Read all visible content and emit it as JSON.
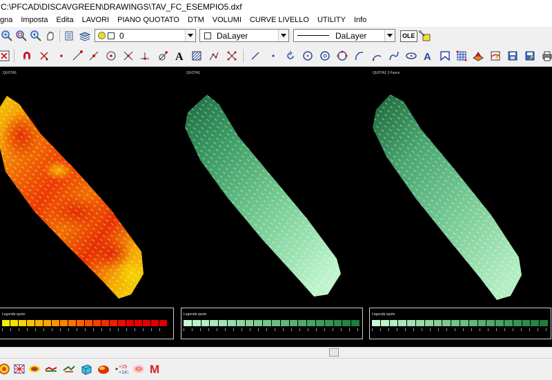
{
  "window": {
    "title": "C:\\PFCAD\\DISCAVGREEN\\DRAWINGS\\TAV_FC_ESEMPIO5.dxf"
  },
  "menu": [
    "gna",
    "Imposta",
    "Edita",
    "LAVORI",
    "PIANO QUOTATO",
    "DTM",
    "VOLUMI",
    "CURVE LIVELLO",
    "UTILITY",
    "Info"
  ],
  "toolbar1": {
    "layer_value": "0",
    "color_value": "DaLayer",
    "linetype_value": "DaLayer",
    "ole_label": "OLE"
  },
  "icons": {
    "toolbar1": [
      "zoom-in-icon",
      "zoom-window-icon",
      "zoom-previous-icon",
      "pan-icon",
      "layer-manager-icon",
      "layer-stack-icon"
    ],
    "toolbar2": [
      "delete-icon",
      "magnet-icon",
      "node-snap-icon",
      "point-snap-icon",
      "endpoint-snap-icon",
      "midpoint-snap-icon",
      "center-snap-icon",
      "intersection-snap-icon",
      "perpendicular-snap-icon",
      "tangent-snap-icon",
      "text-icon",
      "hatch-icon",
      "polyline-edit-icon",
      "multi-snap-icon",
      "line-icon",
      "point-icon",
      "rotate-icon",
      "circle-icon",
      "circle-center-icon",
      "arc-icon",
      "arc-3p-icon",
      "spline-icon",
      "ellipse-icon",
      "text-insert-icon",
      "block-icon",
      "grid-icon",
      "surface-color-icon",
      "dtm-icon",
      "save-icon",
      "export-icon",
      "print-icon"
    ],
    "bottom": [
      "grid-rotate-icon",
      "mesh-icon",
      "contour-icon",
      "profile-icon",
      "volume-cube-icon",
      "fill-color-icon",
      "elevation-points-icon",
      "gradient-map-icon"
    ]
  },
  "viewports": [
    {
      "label": "QUOTA1",
      "legend_title": "Legenda quote",
      "palette": "heat"
    },
    {
      "label": "QUOTA1",
      "legend_title": "Legenda quote",
      "palette": "green"
    },
    {
      "label": "QUOTA1 3 Fasce",
      "legend_title": "Legenda quote",
      "palette": "green"
    }
  ],
  "legend_colors": {
    "heat": [
      "#f2f200",
      "#f6e400",
      "#f8d400",
      "#fac400",
      "#fbb400",
      "#fca400",
      "#fc9400",
      "#fc8400",
      "#fb7400",
      "#fa6200",
      "#f85000",
      "#f63e00",
      "#f42c00",
      "#f21c00",
      "#ef0c00",
      "#ec0000",
      "#e80000",
      "#e40000",
      "#e00000",
      "#dc0000"
    ],
    "green": [
      "#c6f7d3",
      "#bdf2cb",
      "#b4edc3",
      "#aae7bb",
      "#a1e1b3",
      "#98dbab",
      "#8fd5a3",
      "#86cf9b",
      "#7dc993",
      "#74c38b",
      "#6bbd83",
      "#62b77b",
      "#59b073",
      "#50a96b",
      "#47a263",
      "#3e9b5b",
      "#359453",
      "#2c8d4b",
      "#238643",
      "#1a7f3b"
    ]
  },
  "bottom_m_label": "M"
}
